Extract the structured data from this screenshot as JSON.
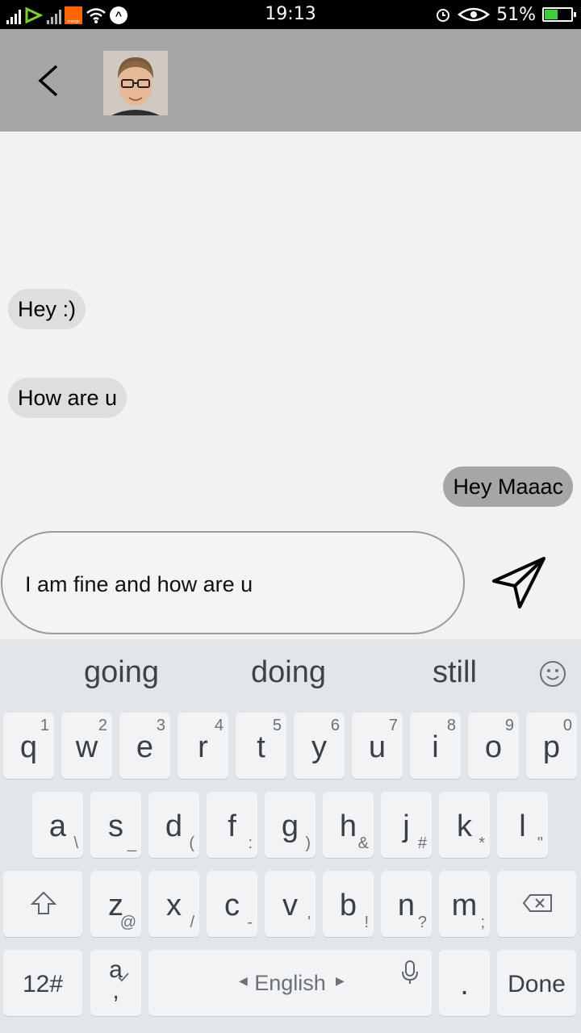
{
  "status_bar": {
    "time": "19:13",
    "battery_percent": "51%",
    "carrier_logo_text": "orange",
    "icons": [
      "signal-bars-icon",
      "carrier-logo-icon",
      "wifi-icon",
      "nav-icon",
      "alarm-icon",
      "eye-icon",
      "battery-charging-icon"
    ]
  },
  "header": {
    "back_icon": "chevron-left-icon",
    "avatar_alt": "contact-avatar"
  },
  "messages": [
    {
      "text": "Hey :)",
      "direction": "incoming"
    },
    {
      "text": "How are u",
      "direction": "incoming"
    },
    {
      "text": "Hey Maaac",
      "direction": "outgoing"
    }
  ],
  "composer": {
    "value": "I am fine and how are u",
    "send_icon": "send-paper-plane-icon"
  },
  "keyboard": {
    "suggestions": [
      "going",
      "doing",
      "still"
    ],
    "row1": [
      {
        "main": "q",
        "sub": "1"
      },
      {
        "main": "w",
        "sub": "2"
      },
      {
        "main": "e",
        "sub": "3"
      },
      {
        "main": "r",
        "sub": "4"
      },
      {
        "main": "t",
        "sub": "5"
      },
      {
        "main": "y",
        "sub": "6"
      },
      {
        "main": "u",
        "sub": "7"
      },
      {
        "main": "i",
        "sub": "8"
      },
      {
        "main": "o",
        "sub": "9"
      },
      {
        "main": "p",
        "sub": "0"
      }
    ],
    "row2": [
      {
        "main": "a",
        "sub": "\\"
      },
      {
        "main": "s",
        "sub": "_"
      },
      {
        "main": "d",
        "sub": "("
      },
      {
        "main": "f",
        "sub": ":"
      },
      {
        "main": "g",
        "sub": ")"
      },
      {
        "main": "h",
        "sub": "&"
      },
      {
        "main": "j",
        "sub": "#"
      },
      {
        "main": "k",
        "sub": "*"
      },
      {
        "main": "l",
        "sub": "\""
      }
    ],
    "row3": [
      {
        "main": "z",
        "sub": "@"
      },
      {
        "main": "x",
        "sub": "/"
      },
      {
        "main": "c",
        "sub": "-"
      },
      {
        "main": "v",
        "sub": "'"
      },
      {
        "main": "b",
        "sub": "!"
      },
      {
        "main": "n",
        "sub": "?"
      },
      {
        "main": "m",
        "sub": ";"
      }
    ],
    "numbers_key": "12#",
    "lang_key_main": "a",
    "lang_key_sub": ",",
    "space_label": "English",
    "period_key": ".",
    "done_key": "Done"
  }
}
